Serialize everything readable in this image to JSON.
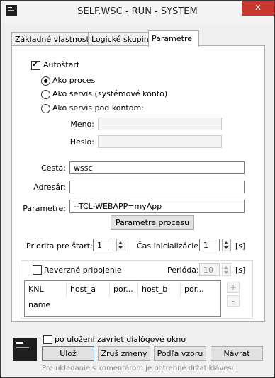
{
  "window": {
    "title": "SELF.WSC - RUN - SYSTEM",
    "close_glyph": "✕"
  },
  "tabs": [
    {
      "label": "Základné vlastnosti",
      "active": false
    },
    {
      "label": "Logické skupiny",
      "active": false
    },
    {
      "label": "Parametre",
      "active": true
    }
  ],
  "autostart": {
    "label": "Autoštart",
    "checked": true
  },
  "run_mode": {
    "options": [
      {
        "label": "Ako proces",
        "selected": true
      },
      {
        "label": "Ako servis (systémové konto)",
        "selected": false
      },
      {
        "label": "Ako servis pod kontom:",
        "selected": false
      }
    ]
  },
  "account": {
    "name_label": "Meno:",
    "name_value": "",
    "password_label": "Heslo:",
    "password_value": ""
  },
  "path": {
    "label": "Cesta:",
    "value": "wssc"
  },
  "directory": {
    "label": "Adresár:",
    "value": ""
  },
  "parameters": {
    "label": "Parametre:",
    "value": "--TCL-WEBAPP=myApp",
    "process_params_button": "Parametre procesu"
  },
  "priority": {
    "label": "Priorita pre štart:",
    "value": "1"
  },
  "init_time": {
    "label": "Čas inicializácie:",
    "value": "1",
    "unit": "[s]"
  },
  "reverse": {
    "label": "Reverzné pripojenie",
    "checked": false,
    "period_label": "Perióda:",
    "period_value": "10",
    "period_unit": "[s]"
  },
  "knl_table": {
    "columns": [
      "KNL name",
      "host_a",
      "por...",
      "host_b",
      "por..."
    ]
  },
  "side_buttons": {
    "add": "+",
    "remove": "-"
  },
  "footer": {
    "close_after_save_label": "po uložení zavrieť dialógové okno",
    "close_after_save_checked": false,
    "save": "Ulož",
    "revert": "Zruš zmeny",
    "by_template": "Podľa vzoru",
    "back": "Návrat",
    "hint": "Pre ukladanie s komentárom je potrebné držať klávesu"
  }
}
